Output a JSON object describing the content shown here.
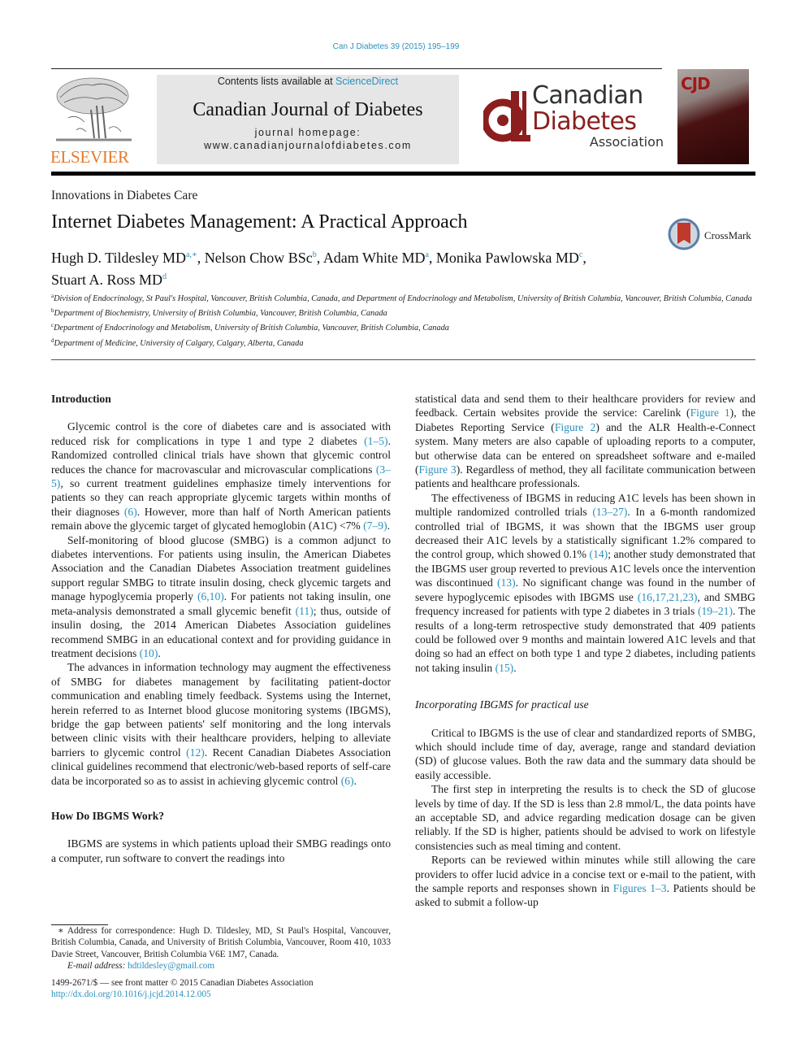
{
  "header": {
    "citation": "Can J Diabetes 39 (2015) 195–199",
    "publisher_logo_text": "ELSEVIER",
    "contents_prefix": "Contents lists available at ",
    "contents_link": "ScienceDirect",
    "journal_name": "Canadian Journal of Diabetes",
    "homepage_label": "journal homepage:",
    "homepage_url": "www.canadianjournalofdiabetes.com",
    "association_logo": {
      "line1": "Canadian",
      "line2": "Diabetes",
      "line3": "Association"
    },
    "cover_title": "CJD",
    "colors": {
      "link_blue": "#2a8fbd",
      "elsevier_orange": "#e8792a",
      "cda_red": "#8b1e1e"
    }
  },
  "article": {
    "section_label": "Innovations in Diabetes Care",
    "title": "Internet Diabetes Management: A Practical Approach",
    "crossmark_label": "CrossMark",
    "authors": [
      {
        "name": "Hugh D. Tildesley MD",
        "sup": "a,∗",
        "sep": ", "
      },
      {
        "name": "Nelson Chow BSc",
        "sup": "b",
        "sep": ", "
      },
      {
        "name": "Adam White MD",
        "sup": "a",
        "sep": ", "
      },
      {
        "name": "Monika Pawlowska MD",
        "sup": "c",
        "sep": ","
      },
      {
        "name": "Stuart A. Ross MD",
        "sup": "d",
        "sep": ""
      }
    ],
    "affiliations": [
      {
        "key": "a",
        "text": "Division of Endocrinology, St Paul's Hospital, Vancouver, British Columbia, Canada, and Department of Endocrinology and Metabolism, University of British Columbia, Vancouver, British Columbia, Canada"
      },
      {
        "key": "b",
        "text": "Department of Biochemistry, University of British Columbia, Vancouver, British Columbia, Canada"
      },
      {
        "key": "c",
        "text": "Department of Endocrinology and Metabolism, University of British Columbia, Vancouver, British Columbia, Canada"
      },
      {
        "key": "d",
        "text": "Department of Medicine, University of Calgary, Calgary, Alberta, Canada"
      }
    ]
  },
  "body": {
    "intro_heading": "Introduction",
    "intro_p1": [
      {
        "t": "Glycemic control is the core of diabetes care and is associated with reduced risk for complications in type 1 and type 2 diabetes "
      },
      {
        "l": "(1–5)"
      },
      {
        "t": ". Randomized controlled clinical trials have shown that glycemic control reduces the chance for macrovascular and microvascular complications "
      },
      {
        "l": "(3–5)"
      },
      {
        "t": ", so current treatment guidelines emphasize timely interventions for patients so they can reach appropriate glycemic targets within months of their diagnoses "
      },
      {
        "l": "(6)"
      },
      {
        "t": ". However, more than half of North American patients remain above the glycemic target of glycated hemoglobin (A1C) <7% "
      },
      {
        "l": "(7–9)"
      },
      {
        "t": "."
      }
    ],
    "intro_p2": [
      {
        "t": "Self-monitoring of blood glucose (SMBG) is a common adjunct to diabetes interventions. For patients using insulin, the American Diabetes Association and the Canadian Diabetes Association treatment guidelines support regular SMBG to titrate insulin dosing, check glycemic targets and manage hypoglycemia properly "
      },
      {
        "l": "(6,10)"
      },
      {
        "t": ". For patients not taking insulin, one meta-analysis demonstrated a small glycemic benefit "
      },
      {
        "l": "(11)"
      },
      {
        "t": "; thus, outside of insulin dosing, the 2014 American Diabetes Association guidelines recommend SMBG in an educational context and for providing guidance in treatment decisions "
      },
      {
        "l": "(10)"
      },
      {
        "t": "."
      }
    ],
    "intro_p3": [
      {
        "t": "The advances in information technology may augment the effectiveness of SMBG for diabetes management by facilitating patient-doctor communication and enabling timely feedback. Systems using the Internet, herein referred to as Internet blood glucose monitoring systems (IBGMS), bridge the gap between patients' self monitoring and the long intervals between clinic visits with their healthcare providers, helping to alleviate barriers to glycemic control "
      },
      {
        "l": "(12)"
      },
      {
        "t": ". Recent Canadian Diabetes Association clinical guidelines recommend that electronic/web-based reports of self-care data be incorporated so as to assist in achieving glycemic control "
      },
      {
        "l": "(6)"
      },
      {
        "t": "."
      }
    ],
    "how_heading": "How Do IBGMS Work?",
    "how_p1_left": "IBGMS are systems in which patients upload their SMBG readings onto a computer, run software to convert the readings into",
    "how_p1_right": [
      {
        "t": "statistical data and send them to their healthcare providers for review and feedback. Certain websites provide the service: Carelink ("
      },
      {
        "l": "Figure 1"
      },
      {
        "t": "), the Diabetes Reporting Service ("
      },
      {
        "l": "Figure 2"
      },
      {
        "t": ") and the ALR Health-e-Connect system. Many meters are also capable of uploading reports to a computer, but otherwise data can be entered on spreadsheet software and e-mailed ("
      },
      {
        "l": "Figure 3"
      },
      {
        "t": "). Regardless of method, they all facilitate communication between patients and healthcare professionals."
      }
    ],
    "how_p2": [
      {
        "t": "The effectiveness of IBGMS in reducing A1C levels has been shown in multiple randomized controlled trials "
      },
      {
        "l": "(13–27)"
      },
      {
        "t": ". In a 6-month randomized controlled trial of IBGMS, it was shown that the IBGMS user group decreased their A1C levels by a statistically significant 1.2% compared to the control group, which showed 0.1% "
      },
      {
        "l": "(14)"
      },
      {
        "t": "; another study demonstrated that the IBGMS user group reverted to previous A1C levels once the intervention was discontinued "
      },
      {
        "l": "(13)"
      },
      {
        "t": ". No significant change was found in the number of severe hypoglycemic episodes with IBGMS use "
      },
      {
        "l": "(16,17,21,23)"
      },
      {
        "t": ", and SMBG frequency increased for patients with type 2 diabetes in 3 trials "
      },
      {
        "l": "(19–21)"
      },
      {
        "t": ". The results of a long-term retrospective study demonstrated that 409 patients could be followed over 9 months and maintain lowered A1C levels and that doing so had an effect on both type 1 and type 2 diabetes, including patients not taking insulin "
      },
      {
        "l": "(15)"
      },
      {
        "t": "."
      }
    ],
    "practical_heading": "Incorporating IBGMS for practical use",
    "practical_p1": "Critical to IBGMS is the use of clear and standardized reports of SMBG, which should include time of day, average, range and standard deviation (SD) of glucose values. Both the raw data and the summary data should be easily accessible.",
    "practical_p2": "The first step in interpreting the results is to check the SD of glucose levels by time of day. If the SD is less than 2.8 mmol/L, the data points have an acceptable SD, and advice regarding medication dosage can be given reliably. If the SD is higher, patients should be advised to work on lifestyle consistencies such as meal timing and content.",
    "practical_p3": [
      {
        "t": "Reports can be reviewed within minutes while still allowing the care providers to offer lucid advice in a concise text or e-mail to the patient, with the sample reports and responses shown in "
      },
      {
        "l": "Figures 1–3"
      },
      {
        "t": ". Patients should be asked to submit a follow-up"
      }
    ]
  },
  "footnote": {
    "correspondence": "∗ Address for correspondence: Hugh D. Tildesley, MD, St Paul's Hospital, Vancouver, British Columbia, Canada, and University of British Columbia, Vancouver, Room 410, 1033 Davie Street, Vancouver, British Columbia V6E 1M7, Canada.",
    "email_label": "E-mail address:",
    "email": "hdtildesley@gmail.com",
    "front_matter": "1499-2671/$ — see front matter © 2015 Canadian Diabetes Association",
    "doi": "http://dx.doi.org/10.1016/j.jcjd.2014.12.005"
  }
}
